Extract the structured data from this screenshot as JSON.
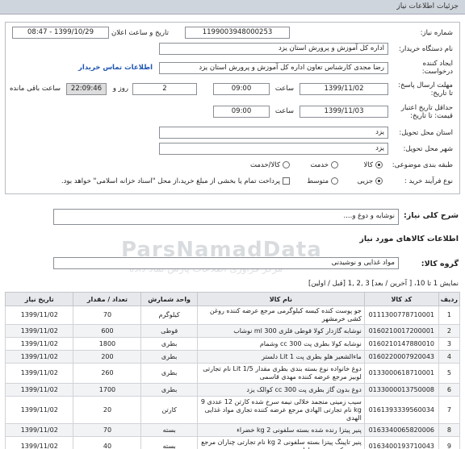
{
  "title": "جزئیات اطلاعات نیاز",
  "form": {
    "need_number_label": "شماره نیاز:",
    "need_number": "1199003948000253",
    "announce_label": "تاریخ و ساعت اعلان عمومی:",
    "announce_value": "1399/10/29 - 08:47",
    "buyer_org_label": "نام دستگاه خریدار:",
    "buyer_org": "اداره کل آموزش و پرورش استان یزد",
    "creator_label": "ایجاد کننده درخواست:",
    "creator": "رضا مجدی کارشناس تعاون اداره کل آموزش و پرورش استان یزد",
    "buyer_contact_link": "اطلاعات تماس خریدار",
    "deadline_label": "مهلت ارسال پاسخ: تا تاریخ:",
    "deadline_date": "1399/11/02",
    "time_label": "ساعت",
    "deadline_time": "09:00",
    "days_value": "2",
    "days_label": "روز و",
    "remaining_value": "22:09:46",
    "remaining_label": "ساعت باقی مانده",
    "validity_label": "حداقل تاریخ اعتبار قیمت: تا تاریخ:",
    "validity_date": "1399/11/03",
    "validity_time": "09:00",
    "province_label": "استان محل تحویل:",
    "province": "یزد",
    "city_label": "شهر محل تحویل:",
    "city": "یزد",
    "category_label": "طبقه بندی موضوعی:",
    "category_options": [
      "کالا",
      "خدمت",
      "کالا/خدمت"
    ],
    "process_label": "نوع فرآیند خرید :",
    "process_options": [
      "جزیی",
      "متوسط"
    ],
    "treasury_note": "پرداخت تمام یا بخشی از مبلغ خرید،از محل \"اسناد خزانه اسلامی\" خواهد بود.",
    "summary_label": "شرح کلی نیاز:",
    "summary": "نوشابه و دوغ و....",
    "goods_header": "اطلاعات کالاهای مورد نیاز",
    "group_label": "گروه کالا:",
    "group_value": "مواد غذایی و نوشیدنی",
    "pagination": "نمایش 1 تا 10، [ آخرین / بعد] 3 ,2 ,1 [قبل / اولین]"
  },
  "table": {
    "headers": [
      "ردیف",
      "کد کالا",
      "نام کالا",
      "واحد شمارش",
      "تعداد / مقدار",
      "تاریخ نیاز"
    ],
    "rows": [
      [
        "1",
        "0111300778710001",
        "جو پوست کنده کیسه کیلوگرمی مرجع عرضه کننده روغن کشی خرمشهر",
        "کیلوگرم",
        "70",
        "1399/11/02"
      ],
      [
        "2",
        "0160210017200001",
        "نوشابه گازدار کولا قوطی فلزی 300 ml نوشاب",
        "قوطی",
        "600",
        "1399/11/02"
      ],
      [
        "3",
        "0160210147880010",
        "نوشابه کولا بطری پت 300 cc وشمام",
        "بطری",
        "1800",
        "1399/11/02"
      ],
      [
        "4",
        "0160220007920043",
        "ماءالشعیر هلو بطری پت 1 Lit دلستر",
        "بطری",
        "200",
        "1399/11/02"
      ],
      [
        "5",
        "0133000618710001",
        "دوغ خانواده نوع بسته بندی بطری مقدار Lit 1/5 نام تجارتی لوبیز مرجع عرضه کننده مهدی قاسمی",
        "بطری",
        "260",
        "1399/11/02"
      ],
      [
        "6",
        "0133000013750008",
        "دوغ بدون گاز بطری پت 300 cc کوالک یزد",
        "بطری",
        "1700",
        "1399/11/02"
      ],
      [
        "7",
        "0161393339560034",
        "سیب زمینی منجمد خلالی نیمه سرخ شده کارتن 12 عددی 9 kg نام تجارتی الهادی مرجع عرضه کننده تجاری مواد غذایی الهدی",
        "کارتن",
        "20",
        "1399/11/02"
      ],
      [
        "8",
        "0163340065820006",
        "پنیر پیتزا رنده شده بسته سلفونی 2 kg خضراء",
        "بسته",
        "70",
        "1399/11/02"
      ],
      [
        "9",
        "0163400193710043",
        "پنیر تاپینگ پیتزا بسته سلفونی 2 kg نام تجارتی چناران مرجع عرضه کننده پنیر چناران",
        "بسته",
        "40",
        "1399/11/02"
      ]
    ]
  },
  "watermark": "ParsNamadData",
  "watermark_sub": "مرکز فرآوری اطلاعات پارس نماد داده"
}
